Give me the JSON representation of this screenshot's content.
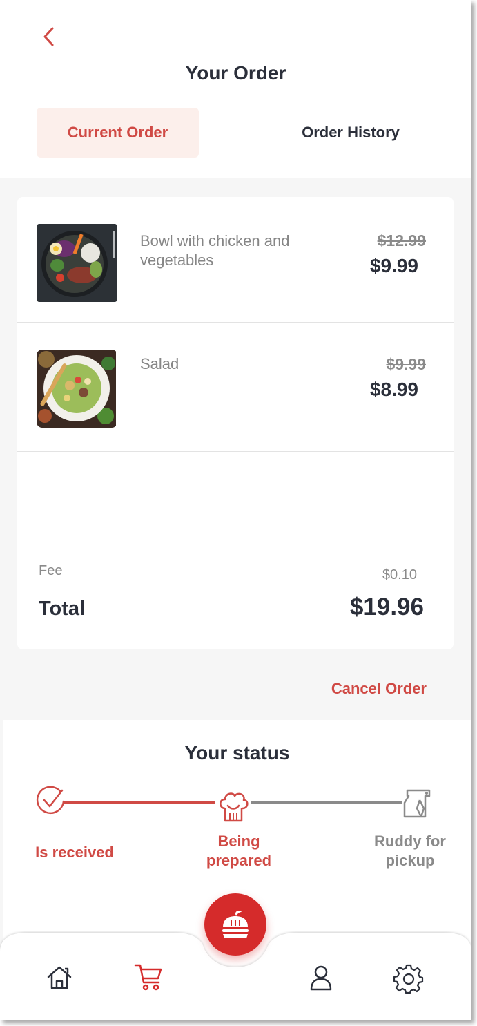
{
  "page": {
    "title": "Your Order",
    "tabs": {
      "current": "Current Order",
      "history": "Order History"
    }
  },
  "order": {
    "items": [
      {
        "name": "Bowl with chicken and vegetables",
        "old_price": "$12.99",
        "price": "$9.99",
        "image_icon": "food-bowl-photo"
      },
      {
        "name": "Salad",
        "old_price": "$9.99",
        "price": "$8.99",
        "image_icon": "salad-photo"
      }
    ],
    "fee_label": "Fee",
    "fee_value": "$0.10",
    "total_label": "Total",
    "total_value": "$19.96",
    "cancel_label": "Cancel Order"
  },
  "status": {
    "title": "Your status",
    "steps": [
      {
        "label": "Is received",
        "state": "done",
        "icon": "checkmark-circle-icon"
      },
      {
        "label": "Being prepared",
        "state": "active",
        "icon": "chef-hat-icon"
      },
      {
        "label": "Ruddy for pickup",
        "state": "pending",
        "icon": "takeaway-bag-icon"
      }
    ]
  },
  "nav": {
    "items": [
      "home-icon",
      "cart-icon",
      "burger-icon",
      "user-icon",
      "settings-icon"
    ],
    "active": "cart-icon"
  },
  "colors": {
    "accent": "#d04a45",
    "fab": "#d52b2b",
    "text": "#2b2f3a",
    "muted": "#8a8a8a",
    "tab_bg": "#fcefeb"
  }
}
